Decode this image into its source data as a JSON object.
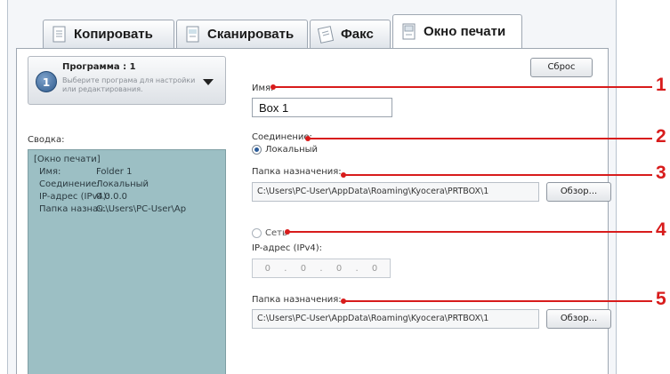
{
  "tabs": [
    {
      "label": "Копировать",
      "icon": "copy-icon",
      "active": false
    },
    {
      "label": "Сканировать",
      "icon": "scan-icon",
      "active": false
    },
    {
      "label": "Факс",
      "icon": "fax-icon",
      "active": false
    },
    {
      "label": "Окно печати",
      "icon": "print-box-icon",
      "active": true
    }
  ],
  "program": {
    "badge": "1",
    "title": "Программа : 1",
    "hint": "Выберите програма для настройки или редактирования."
  },
  "summary": {
    "label": "Сводка:",
    "header": "[Окно печати]",
    "rows": [
      {
        "key": "Имя:",
        "value": "Folder 1"
      },
      {
        "key": "Соединение:",
        "value": "Локальный"
      },
      {
        "key": "IP-адрес (IPv4):",
        "value": "0.0.0.0"
      },
      {
        "key": "Папка назнач...",
        "value": "C:\\Users\\PC-User\\Ap"
      }
    ]
  },
  "form": {
    "reset_label": "Сброс",
    "name_label": "Имя:",
    "name_value": "Box 1",
    "connection_label": "Соединение:",
    "local_label": "Локальный",
    "local_selected": true,
    "dest_label_local": "Папка назначения:",
    "dest_path_local": "C:\\Users\\PC-User\\AppData\\Roaming\\Kyocera\\PRTBOX\\1",
    "browse_label": "Обзор...",
    "network_label": "Сеть",
    "network_selected": false,
    "ip_label": "IP-адрес (IPv4):",
    "ip_octets": [
      "0",
      "0",
      "0",
      "0"
    ],
    "dest_label_network": "Папка назначения:",
    "dest_path_network": "C:\\Users\\PC-User\\AppData\\Roaming\\Kyocera\\PRTBOX\\1"
  },
  "callouts": [
    "1",
    "2",
    "3",
    "4",
    "5"
  ],
  "colors": {
    "callout": "#d81c1c",
    "summary_bg": "#9cbfc4",
    "badge": "#2e5a8c"
  }
}
